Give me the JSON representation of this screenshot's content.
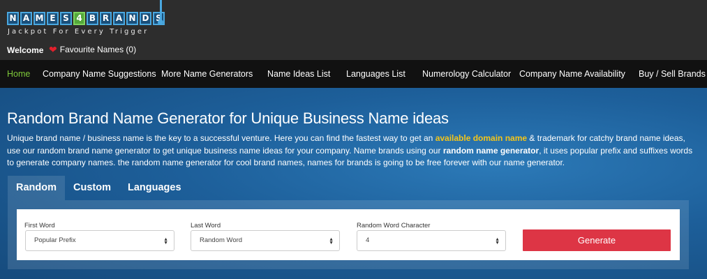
{
  "logo": {
    "letters": [
      "N",
      "A",
      "M",
      "E",
      "S",
      "4",
      "B",
      "R",
      "A",
      "N",
      "D",
      "S"
    ],
    "tagline": "Jackpot For Every Trigger"
  },
  "header": {
    "welcome": "Welcome",
    "favourites": "Favourite Names (0)"
  },
  "nav": {
    "items": [
      {
        "label": "Home",
        "active": true
      },
      {
        "label": "Company Name Suggestions"
      },
      {
        "label": "More Name Generators"
      },
      {
        "label": "Name Ideas List"
      },
      {
        "label": "Languages List"
      },
      {
        "label": "Numerology Calculator"
      },
      {
        "label": "Company Name Availability"
      },
      {
        "label": "Buy / Sell Brands"
      }
    ]
  },
  "main": {
    "title": "Random Brand Name Generator for Unique Business Name ideas",
    "intro": {
      "part1": "Unique brand name / business name is the key to a successful venture. Here you can find the fastest way to get an ",
      "link1": "available domain name",
      "part2": " & trademark for catchy brand name ideas, use our random brand name generator to get unique business name ideas for your company. Name brands using our ",
      "bold1": "random name generator",
      "part3": ", it uses popular prefix and suffixes words to generate company names. the random name generator for cool brand names, names for brands is going to be free forever with our name generator."
    },
    "tabs": [
      {
        "label": "Random",
        "active": true
      },
      {
        "label": "Custom"
      },
      {
        "label": "Languages"
      }
    ],
    "form": {
      "first_word": {
        "label": "First Word",
        "value": "Popular Prefix"
      },
      "last_word": {
        "label": "Last Word",
        "value": "Random Word"
      },
      "random_char": {
        "label": "Random Word Character",
        "value": "4"
      },
      "generate_label": "Generate"
    }
  },
  "colors": {
    "accent_green": "#7ec83a",
    "highlight_yellow": "#f5c518",
    "generate_red": "#dd3545",
    "heart_red": "#e2202c"
  },
  "icons": {
    "favourite": "heart-icon",
    "select_arrows": "updown-arrows-icon"
  }
}
